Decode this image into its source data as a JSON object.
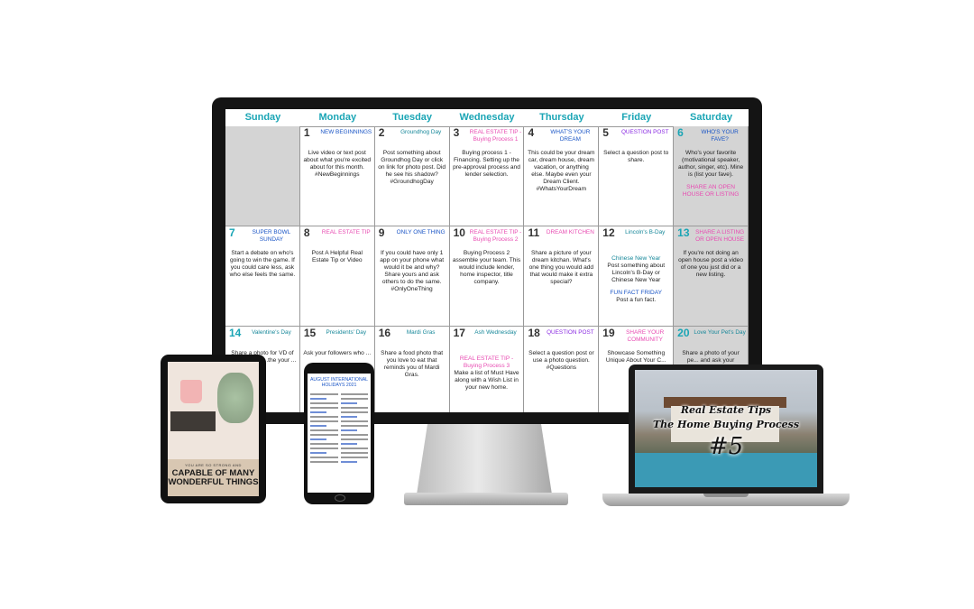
{
  "calendar": {
    "days": [
      "Sunday",
      "Monday",
      "Tuesday",
      "Wednesday",
      "Thursday",
      "Friday",
      "Saturday"
    ],
    "weeks": [
      [
        {
          "num": "",
          "label": "",
          "body": "",
          "gray": true
        },
        {
          "num": "1",
          "label": "NEW BEGINNINGS",
          "color": "c-blue",
          "body": "Live video or text post about what you're excited about for this month. #NewBeginnings"
        },
        {
          "num": "2",
          "label": "Groundhog Day",
          "color": "c-teal",
          "body": "Post something about Groundhog Day or click on link for photo post. Did he see his shadow? #GroundhogDay"
        },
        {
          "num": "3",
          "label": "REAL ESTATE TIP - Buying Process 1",
          "color": "c-pink",
          "body": "Buying process 1 - Financing. Setting up the pre-approval process and lender selection."
        },
        {
          "num": "4",
          "label": "WHAT'S YOUR DREAM",
          "color": "c-blue",
          "body": "This could be your dream car, dream house, dream vacation, or anything else. Maybe even your Dream Client. #WhatsYourDream"
        },
        {
          "num": "5",
          "label": "QUESTION POST",
          "color": "c-purple",
          "body": "Select a question post to share."
        },
        {
          "num": "6",
          "label": "WHO'S YOUR FAVE?",
          "color": "c-blue",
          "body": "Who's your favorite (motivational speaker, author, singer, etc). Mine is (list your fave).",
          "extra": "SHARE AN OPEN HOUSE OR LISTING",
          "extraColor": "c-pink",
          "gray": true,
          "numTeal": true
        }
      ],
      [
        {
          "num": "7",
          "label": "SUPER BOWL SUNDAY",
          "color": "c-blue",
          "body": "Start a debate on who's going to win the game. If you could care less, ask who else feels the same.",
          "numTeal": true
        },
        {
          "num": "8",
          "label": "REAL ESTATE TIP",
          "color": "c-pink",
          "body": "Post A Helpful Real Estate Tip or Video"
        },
        {
          "num": "9",
          "label": "ONLY ONE THING",
          "color": "c-blue",
          "body": "If you could have only 1 app on your phone what would it be and why? Share yours and ask others to do the same. #OnlyOneThing"
        },
        {
          "num": "10",
          "label": "REAL ESTATE TIP - Buying Process 2",
          "color": "c-pink",
          "body": "Buying Process 2 assemble your team. This would include lender, home inspector, title company."
        },
        {
          "num": "11",
          "label": "DREAM KITCHEN",
          "color": "c-pink",
          "body": "Share a picture of your dream kitchan. What's one thing you would add that would make it extra special?"
        },
        {
          "num": "12",
          "label": "Lincoln's B-Day",
          "color": "c-teal",
          "body": "",
          "extra": "Chinese New Year",
          "extraColor": "c-teal",
          "extraBody": "Post something about Lincoln's B-Day or Chinese New Year",
          "extra2": "FUN FACT FRIDAY",
          "extra2Color": "c-blue",
          "extra2Body": "Post a fun fact."
        },
        {
          "num": "13",
          "label": "SHARE A LISTING OR OPEN HOUSE",
          "color": "c-pink",
          "body": "If you're not doing an open house post a video of one you just did or a new listing.",
          "gray": true,
          "numTeal": true
        }
      ],
      [
        {
          "num": "14",
          "label": "Valentine's Day",
          "color": "c-teal",
          "body": "Share a photo for VD of ...rt. Or tell a ...the your ...",
          "numTeal": true
        },
        {
          "num": "15",
          "label": "Presidents' Day",
          "color": "c-teal",
          "body": "Ask your followers who ..."
        },
        {
          "num": "16",
          "label": "Mardi Gras",
          "color": "c-teal",
          "body": "Share a food photo that you love to eat that reminds you of Mardi Gras."
        },
        {
          "num": "17",
          "label": "Ash Wednesday",
          "color": "c-teal",
          "body": "",
          "extra": "REAL ESTATE TIP - Buying Process 3",
          "extraColor": "c-pink",
          "extraBody": "Make a list of Must Have along with a Wish List in your new home."
        },
        {
          "num": "18",
          "label": "QUESTION POST",
          "color": "c-purple",
          "body": "Select a question post or use a photo question. #Questions"
        },
        {
          "num": "19",
          "label": "SHARE YOUR COMMUNITY",
          "color": "c-pink",
          "body": "Showcase Something Unique About Your C..."
        },
        {
          "num": "20",
          "label": "Love Your Pet's Day",
          "color": "c-teal",
          "body": "Share a photo of your pe... and ask your followers to ...",
          "gray": true,
          "numTeal": true
        }
      ]
    ]
  },
  "tablet": {
    "quote_small": "YOU ARE SO STRONG AND",
    "quote_big": "CAPABLE OF MANY WONDERFUL THINGS"
  },
  "phone": {
    "title": "AUGUST INTERNATIONAL HOLIDAYS 2021"
  },
  "laptop": {
    "title_line1": "Real Estate Tips",
    "title_line2": "The Home Buying Process",
    "number": "#5"
  }
}
